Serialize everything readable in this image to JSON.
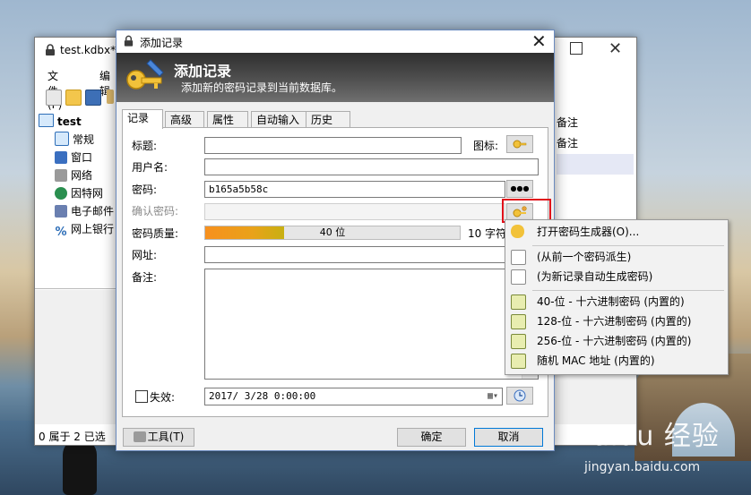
{
  "main_window": {
    "title": "test.kdbx*",
    "menu": [
      "文件(F)",
      "编辑"
    ],
    "tree_root": "test",
    "tree_items": [
      "常规",
      "窗口",
      "网络",
      "因特网",
      "电子邮件",
      "网上银行"
    ],
    "entries_right": [
      "备注",
      "备注"
    ],
    "status": "0 属于 2 已选"
  },
  "dialog": {
    "title": "添加记录",
    "banner_title": "添加记录",
    "banner_subtitle": "添加新的密码记录到当前数据库。",
    "tabs": [
      "记录",
      "高级",
      "属性",
      "自动输入",
      "历史"
    ],
    "labels": {
      "title": "标题:",
      "icon": "图标:",
      "username": "用户名:",
      "password": "密码:",
      "confirm": "确认密码:",
      "quality": "密码质量:",
      "url": "网址:",
      "notes": "备注:",
      "expires": "失效:"
    },
    "password_value": "b165a5b58c",
    "quality_text": "40 位",
    "quality_fraction": 0.31,
    "chars_text": "10 字符",
    "expires_value": "2017/ 3/28   0:00:00",
    "show_password_glyph": "●●●",
    "tools_button": "工具(T)",
    "ok_button": "确定",
    "cancel_button": "取消"
  },
  "context_menu": {
    "items": [
      "打开密码生成器(O)...",
      "(从前一个密码派生)",
      "(为新记录自动生成密码)",
      "40-位 - 十六进制密码 (内置的)",
      "128-位 - 十六进制密码 (内置的)",
      "256-位 - 十六进制密码 (内置的)",
      "随机 MAC 地址 (内置的)"
    ]
  },
  "watermark": {
    "logo": "Baidu 经验",
    "url": "jingyan.baidu.com"
  },
  "colors": {
    "highlight_border": "#e0101a",
    "quality_fill": "#f7901e"
  }
}
